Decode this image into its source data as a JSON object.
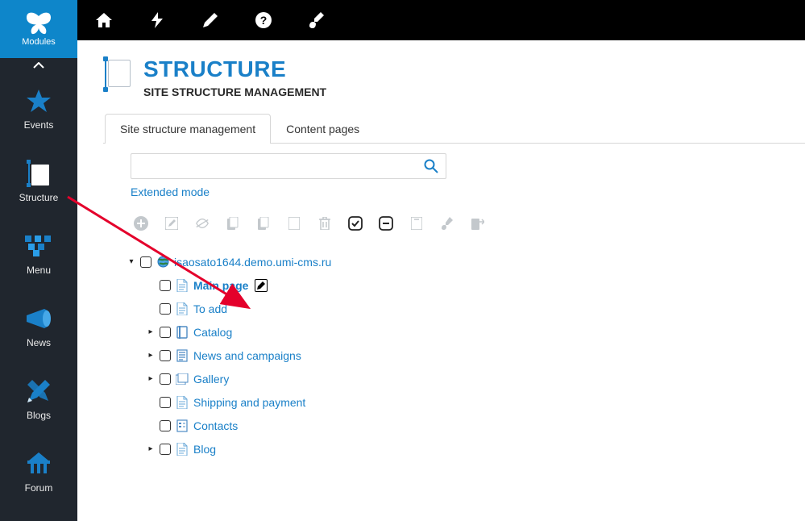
{
  "sidebar": {
    "modules_label": "Modules",
    "items": [
      {
        "label": "Events"
      },
      {
        "label": "Structure"
      },
      {
        "label": "Menu"
      },
      {
        "label": "News"
      },
      {
        "label": "Blogs"
      },
      {
        "label": "Forum"
      }
    ]
  },
  "header": {
    "title": "STRUCTURE",
    "subtitle": "SITE STRUCTURE MANAGEMENT"
  },
  "tabs": [
    {
      "label": "Site structure management",
      "active": true
    },
    {
      "label": "Content pages",
      "active": false
    }
  ],
  "search": {
    "placeholder": "",
    "extended_label": "Extended mode"
  },
  "tree": {
    "root": "isaosato1644.demo.umi-cms.ru",
    "nodes": [
      {
        "label": "Main page",
        "bold": true,
        "edit": true,
        "expandable": false,
        "icon": "page"
      },
      {
        "label": "To add",
        "expandable": false,
        "icon": "page"
      },
      {
        "label": "Catalog",
        "expandable": true,
        "icon": "catalog"
      },
      {
        "label": "News and campaigns",
        "expandable": true,
        "icon": "news"
      },
      {
        "label": "Gallery",
        "expandable": true,
        "icon": "gallery"
      },
      {
        "label": "Shipping and payment",
        "expandable": false,
        "icon": "page"
      },
      {
        "label": "Contacts",
        "expandable": false,
        "icon": "form"
      },
      {
        "label": "Blog",
        "expandable": true,
        "icon": "page"
      }
    ]
  }
}
